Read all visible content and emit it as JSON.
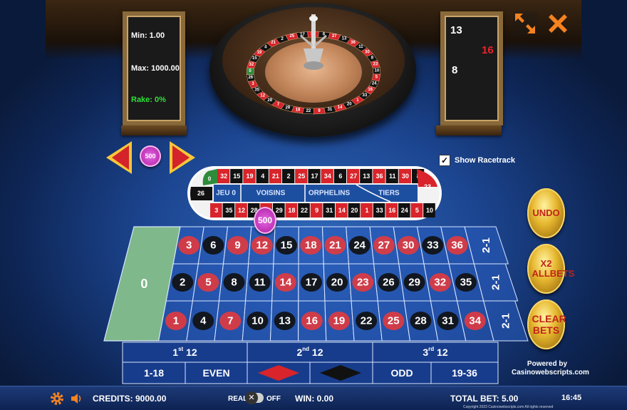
{
  "info": {
    "min": "Min: 1.00",
    "max": "Max: 1000.00",
    "rake": "Rake: 0%"
  },
  "history": [
    {
      "value": "13",
      "color": "#ffffff"
    },
    {
      "value": "16",
      "color": "#e8232a"
    },
    {
      "value": "8",
      "color": "#ffffff"
    }
  ],
  "chip": {
    "value": "500"
  },
  "placed_chip": {
    "value": "500"
  },
  "wheel_visible_numbers": [
    "2",
    "25",
    "17",
    "34",
    "6",
    "27",
    "13",
    "36",
    "11",
    "30",
    "8",
    "23",
    "10",
    "5",
    "24",
    "16",
    "33",
    "1",
    "20",
    "14",
    "31",
    "9",
    "22",
    "18",
    "29",
    "7",
    "28",
    "12",
    "35",
    "3",
    "26",
    "0",
    "32",
    "15",
    "19",
    "4",
    "21"
  ],
  "show_racetrack": {
    "label": "Show Racetrack",
    "checked": true
  },
  "racetrack": {
    "top": [
      "32",
      "15",
      "19",
      "4",
      "21",
      "2",
      "25",
      "17",
      "34",
      "6",
      "27",
      "13",
      "36",
      "11",
      "30",
      "8"
    ],
    "bottom": [
      "3",
      "35",
      "12",
      "28",
      "7",
      "29",
      "18",
      "22",
      "9",
      "31",
      "14",
      "20",
      "1",
      "33",
      "16",
      "24",
      "5",
      "10"
    ],
    "left": [
      "0",
      "26"
    ],
    "right": [
      "23"
    ],
    "sections": [
      "JEU 0",
      "VOISINS",
      "ORPHELINS",
      "TIERS"
    ]
  },
  "table": {
    "zero": "0",
    "rows": [
      [
        "3",
        "6",
        "9",
        "12",
        "15",
        "18",
        "21",
        "24",
        "27",
        "30",
        "33",
        "36"
      ],
      [
        "2",
        "5",
        "8",
        "11",
        "14",
        "17",
        "20",
        "23",
        "26",
        "29",
        "32",
        "35"
      ],
      [
        "1",
        "4",
        "7",
        "10",
        "13",
        "16",
        "19",
        "22",
        "25",
        "28",
        "31",
        "34"
      ]
    ],
    "columns": [
      "2-1",
      "2-1",
      "2-1"
    ],
    "dozens": [
      "1st 12",
      "2nd 12",
      "3rd 12"
    ],
    "outside": [
      "1-18",
      "EVEN",
      "ODD",
      "19-36"
    ],
    "red_numbers": [
      "1",
      "3",
      "5",
      "7",
      "9",
      "12",
      "14",
      "16",
      "18",
      "19",
      "21",
      "23",
      "25",
      "27",
      "30",
      "32",
      "34",
      "36"
    ],
    "colors": {
      "red": "#d8242a",
      "black": "#111111",
      "green": "#2e8b3a"
    }
  },
  "buttons": {
    "undo": "UNDO",
    "x2": "X2 ALLBETS",
    "clear": "CLEAR BETS"
  },
  "powered": {
    "line1": "Powered by",
    "line2": "Casinowebscripts.com"
  },
  "bottom": {
    "credits": "CREDITS: 9000.00",
    "real": "REAL",
    "off": "OFF",
    "win": "WIN: 0.00",
    "total_bet": "TOTAL BET: 5.00",
    "time": "16:45",
    "copyright": "Copyright 2023 Casinowebscripts.com All rights reserved"
  }
}
